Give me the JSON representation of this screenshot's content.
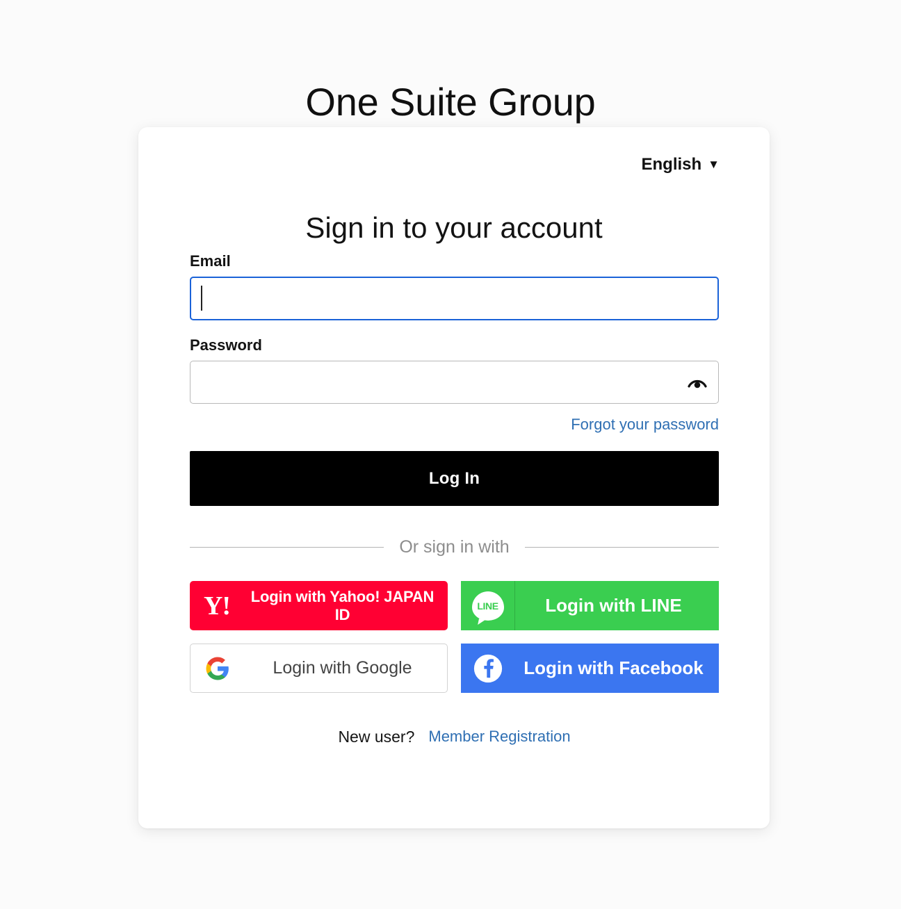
{
  "brand": {
    "title": "One Suite Group"
  },
  "language": {
    "selected": "English",
    "caret": "▼"
  },
  "signin": {
    "headline": "Sign in to your account",
    "email": {
      "label": "Email",
      "value": "",
      "placeholder": ""
    },
    "password": {
      "label": "Password",
      "value": "",
      "placeholder": "",
      "toggle_icon": "eye-icon"
    },
    "forgot_password": "Forgot your password",
    "login_button": "Log In",
    "divider_label": "Or sign in with"
  },
  "social": {
    "yahoo": {
      "label": "Login with Yahoo! JAPAN ID",
      "logo": "Y!",
      "color": "#FF0033"
    },
    "line": {
      "label": "Login with LINE",
      "logo": "LINE",
      "color": "#3ACE50"
    },
    "google": {
      "label": "Login with Google",
      "logo": "google-g-icon",
      "color": "#FFFFFF"
    },
    "facebook": {
      "label": "Login with Facebook",
      "logo": "facebook-f-icon",
      "color": "#3B76F0"
    }
  },
  "footer": {
    "new_user_text": "New user?",
    "register_link": "Member Registration"
  },
  "theme": {
    "accent_blue": "#1A62D8",
    "link_blue": "#2F6FB3",
    "primary_button": "#000000",
    "page_background": "#FBFBFB",
    "card_background": "#FFFFFF"
  }
}
